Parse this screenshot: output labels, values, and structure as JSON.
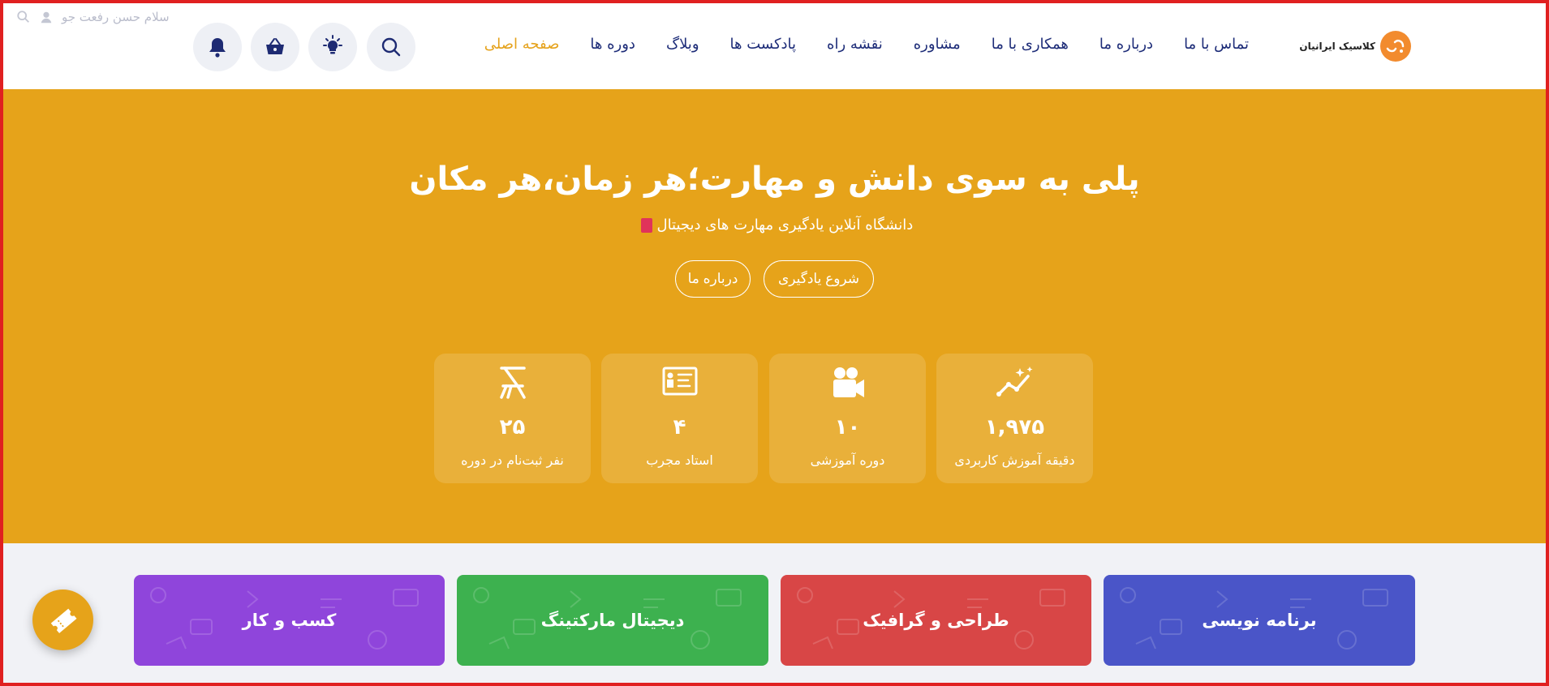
{
  "header": {
    "greeting": "سلام حسن رفعت جو",
    "logo_text": "کلاسیک ایرانیان",
    "nav": [
      {
        "label": "صفحه اصلی",
        "active": true
      },
      {
        "label": "دوره ها",
        "active": false
      },
      {
        "label": "وبلاگ",
        "active": false
      },
      {
        "label": "پادکست ها",
        "active": false
      },
      {
        "label": "نقشه راه",
        "active": false
      },
      {
        "label": "مشاوره",
        "active": false
      },
      {
        "label": "همکاری با ما",
        "active": false
      },
      {
        "label": "درباره ما",
        "active": false
      },
      {
        "label": "تماس با ما",
        "active": false
      }
    ],
    "icons": [
      "search-icon",
      "lightbulb-icon",
      "basket-icon",
      "bell-icon"
    ]
  },
  "hero": {
    "title": "پلی به سوی دانش و مهارت؛هر زمان،هر مکان",
    "subtitle": "دانشگاه آنلاین یادگیری مهارت های دیجیتال",
    "start_button": "شروع یادگیری",
    "about_button": "درباره ما"
  },
  "stats": [
    {
      "value": "۱,۹۷۵",
      "label": "دقیقه آموزش کاربردی",
      "icon": "trend-sparkle-icon"
    },
    {
      "value": "۱۰",
      "label": "دوره آموزشی",
      "icon": "video-camera-icon"
    },
    {
      "value": "۴",
      "label": "استاد مجرب",
      "icon": "presentation-board-icon"
    },
    {
      "value": "۲۵",
      "label": "نفر ثبت‌نام در دوره",
      "icon": "student-chair-icon"
    }
  ],
  "categories": [
    {
      "label": "برنامه نویسی",
      "color": "#4a55c8"
    },
    {
      "label": "طراحی و گرافیک",
      "color": "#d84646"
    },
    {
      "label": "دیجیتال مارکتینگ",
      "color": "#3db14f"
    },
    {
      "label": "کسب و کار",
      "color": "#8f45db"
    }
  ],
  "colors": {
    "accent": "#e6a31a",
    "nav_text": "#1d2c78",
    "frame": "#e02020"
  }
}
